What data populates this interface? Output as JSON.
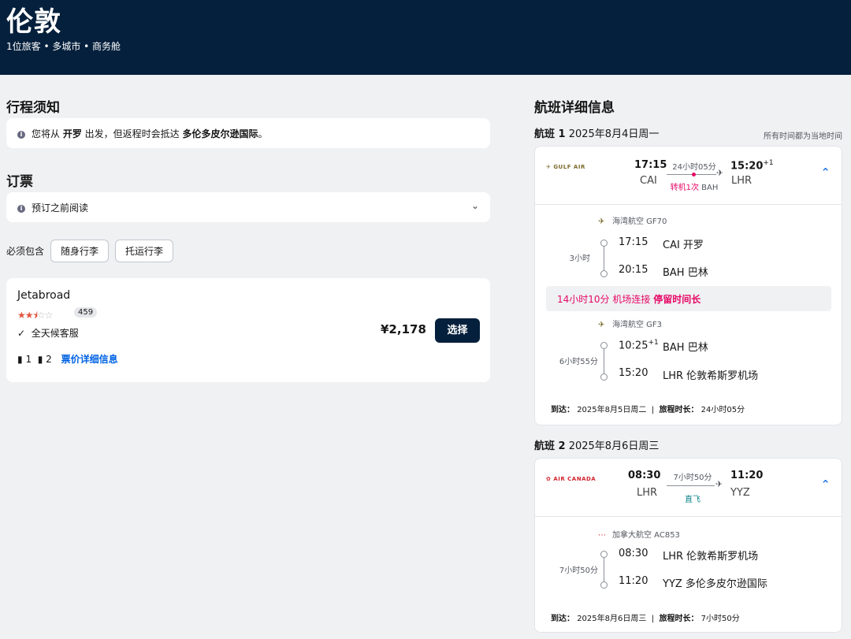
{
  "header": {
    "title": "伦敦",
    "subtitle": "1位旅客 • 多城市 • 商务舱"
  },
  "left": {
    "trip_notice_title": "行程须知",
    "notice": {
      "pre": "您将从 ",
      "city1": "开罗",
      "mid": " 出发，但返程时会抵达 ",
      "city2": "多伦多皮尔逊国际",
      "post": "。"
    },
    "booking_title": "订票",
    "read_before": "预订之前阅读",
    "included_label": "必须包含",
    "pills": [
      "随身行李",
      "托运行李"
    ],
    "provider": {
      "name": "Jetabroad",
      "rating": 2.5,
      "reviews": "459",
      "service": "全天候客服",
      "carry": "1",
      "checked": "2",
      "fare_link": "票价详细信息",
      "price": "¥2,178",
      "select": "选择"
    }
  },
  "right": {
    "title": "航班详细信息",
    "timezone_note": "所有时间都为当地时间",
    "legs": [
      {
        "label": "航班 1",
        "date": "2025年8月4日周一",
        "airline_logo": "GULF AIR",
        "dep_time": "17:15",
        "arr_time": "15:20",
        "arr_plus": "+1",
        "from": "CAI",
        "to": "LHR",
        "duration": "24小时05分",
        "stops": "转机1次",
        "stop_code": "BAH",
        "segments": [
          {
            "airline": "海湾航空 GF70",
            "seg_duration": "3小时",
            "dep_time": "17:15",
            "dep_plus": "",
            "dep_airport": "CAI 开罗",
            "arr_time": "20:15",
            "arr_airport": "BAH 巴林"
          },
          {
            "airline": "海湾航空 GF3",
            "seg_duration": "6小时55分",
            "dep_time": "10:25",
            "dep_plus": "+1",
            "dep_airport": "BAH 巴林",
            "arr_time": "15:20",
            "arr_airport": "LHR 伦敦希斯罗机场"
          }
        ],
        "layover": {
          "duration": "14小时10分",
          "type": "机场连接",
          "warning": "停留时间长"
        },
        "arrival_label": "到达：",
        "arrival": "2025年8月5日周二",
        "trip_label": "旅程时长：",
        "trip": "24小时05分"
      },
      {
        "label": "航班 2",
        "date": "2025年8月6日周三",
        "airline_logo": "AIR CANADA",
        "dep_time": "08:30",
        "arr_time": "11:20",
        "from": "LHR",
        "to": "YYZ",
        "duration": "7小时50分",
        "stops": "直飞",
        "segments": [
          {
            "airline": "加拿大航空 AC853",
            "seg_duration": "7小时50分",
            "dep_time": "08:30",
            "dep_airport": "LHR 伦敦希斯罗机场",
            "arr_time": "11:20",
            "arr_airport": "YYZ 多伦多皮尔逊国际"
          }
        ],
        "arrival_label": "到达：",
        "arrival": "2025年8月6日周三",
        "trip_label": "旅程时长：",
        "trip": "7小时50分"
      }
    ]
  },
  "colors": {
    "header_bg": "#05203c",
    "accent": "#0062e3",
    "warning": "#e70866",
    "star": "#e25740"
  }
}
